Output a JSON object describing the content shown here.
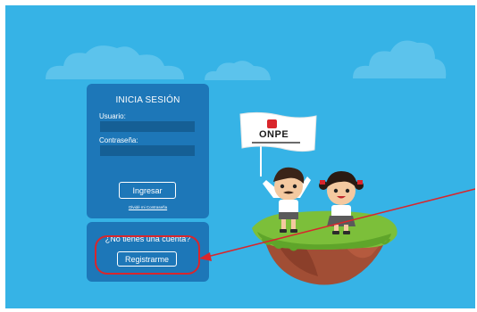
{
  "login": {
    "title": "INICIA SESIÓN",
    "username_label": "Usuario:",
    "username_value": "",
    "password_label": "Contraseña:",
    "password_value": "",
    "submit_label": "Ingresar",
    "forgot_label": "Olvidé mi Contraseña"
  },
  "register": {
    "question": "¿No tienes una cuenta?",
    "button_label": "Registrarme"
  },
  "flag": {
    "logo_text": "ONPE"
  },
  "colors": {
    "background": "#36b3e6",
    "panel": "#1d77b8",
    "input": "#155f95",
    "annotation": "#d9262c"
  }
}
